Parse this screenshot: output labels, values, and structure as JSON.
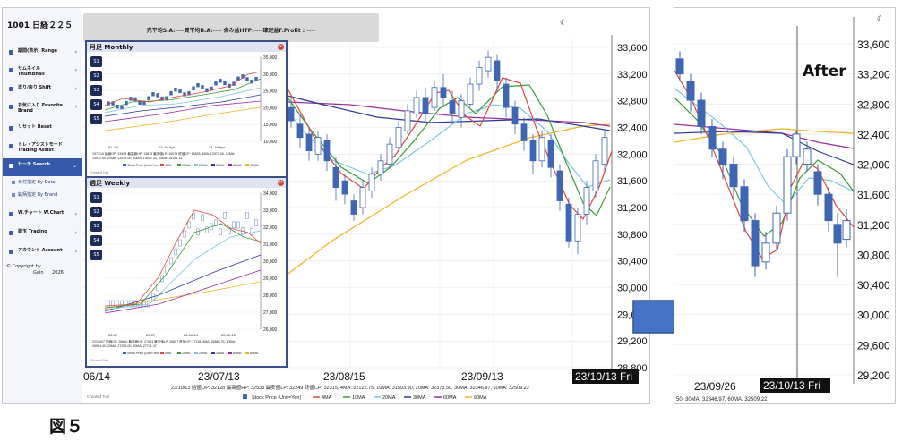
{
  "app": {
    "title": "1001 日経２２５",
    "sidebar": {
      "items": [
        {
          "icon": "range-icon",
          "label": "期間(表示) Range"
        },
        {
          "icon": "thumbnail-icon",
          "label": "サムネイル Thumbnail"
        },
        {
          "icon": "shift-icon",
          "label": "送り/戻り Shift"
        },
        {
          "icon": "favorite-icon",
          "label": "お気に入り Favorite Brand"
        },
        {
          "icon": "reset-icon",
          "label": "リセット Reset"
        },
        {
          "icon": "trade-assist-icon",
          "label": "トレ・アシストモード Trading Assist"
        },
        {
          "icon": "search-icon",
          "label": "サーチ Search"
        },
        {
          "icon": "chart-icon",
          "label": "W.チャート W.Chart"
        },
        {
          "icon": "trading-icon",
          "label": "建玉 Trading"
        },
        {
          "icon": "account-icon",
          "label": "アカウント Account"
        }
      ],
      "search_sub": [
        "日付指定 By Date",
        "銘柄指定 By Brand"
      ],
      "copyright": "© Copyright by",
      "company": "Gain",
      "year": "2026"
    },
    "topbar": "売平均S.A:----買平均B.A:---- 含み益HTP:----確定益F.Profit : ----",
    "y_ticks": [
      "33,600",
      "33,200",
      "32,800",
      "32,400",
      "32,000",
      "31,600",
      "31,200",
      "30,800",
      "30,400",
      "30,000",
      "29,600",
      "29,200",
      "28,800"
    ],
    "x_ticks": [
      "06/14",
      "23/07/13",
      "23/08/15",
      "23/09/13"
    ],
    "x_current": "23/10/13 Fri",
    "info_line": "23/10/13 始値OP: 32128 最高値HP: 32533 最安値LP: 32249 終値CP: 32315, 4MA: 32122.75, 10MA: 31593.90, 20MA: 32373.50, 30MA: 32346.97, 60MA: 32509.22",
    "legend": [
      "Stock Price (Unit=Yen)",
      "4MA",
      "10MA",
      "20MA",
      "30MA",
      "60MA",
      "90MA"
    ],
    "footer_brand": "Created Tool",
    "popups": {
      "monthly": {
        "title": "月足 Monthly",
        "buttons": [
          "S1",
          "S2",
          "S3",
          "S4",
          "S5"
        ],
        "y_ticks": [
          "35,000",
          "30,000",
          "25,000",
          "20,000",
          "15,000",
          "10,000"
        ],
        "x_ticks": [
          "91-Jul",
          "03-Jul Apr",
          "21-Jul Apr"
        ],
        "info": "1977/10 始値OP: 13493 最高値HP: 13875 最安値LP: 10074 終値CP: 13825, 4MA: 13971.00, 10MA: 13971.00, 20MA: 13971.00, 30MA: 14032.33, 60MA: 14155.13",
        "legend": [
          "Stock Price (Unit=Yen)",
          "4MA",
          "10MA",
          "20MA",
          "30MA",
          "60MA",
          "90MA"
        ],
        "footer": "Created Tool"
      },
      "weekly": {
        "title": "週足 Weekly",
        "buttons": [
          "S1",
          "S2",
          "S3",
          "S4",
          "S5"
        ],
        "y_ticks": [
          "34,000",
          "33,000",
          "32,000",
          "31,000",
          "30,000",
          "29,000",
          "28,000",
          "27,000",
          "26,000"
        ],
        "x_ticks": [
          "22-07",
          "22-07",
          "22-10-14",
          "22-10-15"
        ],
        "info": "22/10/07 始値OP: 26880 最高値HP: 27053 最安値LP: 26697 終値CP: 27116, 4MA: 26885.75, 10MA: 26994.40, 20MA: 27250.00, 30MA: 27741.47",
        "legend": [
          "Stock Price (Unit=Yen)",
          "4MA",
          "10MA",
          "20MA",
          "30MA",
          "60MA",
          "90MA"
        ],
        "footer": "Created Tool"
      }
    }
  },
  "zoom": {
    "label": "After",
    "y_ticks": [
      "33,600",
      "33,200",
      "32,800",
      "32,400",
      "32,000",
      "31,600",
      "31,200",
      "30,800",
      "30,400",
      "30,000",
      "29,600",
      "29,200"
    ],
    "x_ticks": [
      "23/09/26"
    ],
    "x_current": "23/10/13 Fri",
    "info": "50, 30MA: 32346.97, 60MA: 32509.22"
  },
  "figure_label": "図５",
  "colors": {
    "candle": "#3f66b3",
    "ma4": "#e0463f",
    "ma10": "#3a9a3a",
    "ma20": "#7bc7e6",
    "ma30": "#2b3a9a",
    "ma60": "#9b2fa0",
    "ma90": "#f0b323",
    "arrow": "#4472c4",
    "sidebar_active": "#3559a8"
  }
}
